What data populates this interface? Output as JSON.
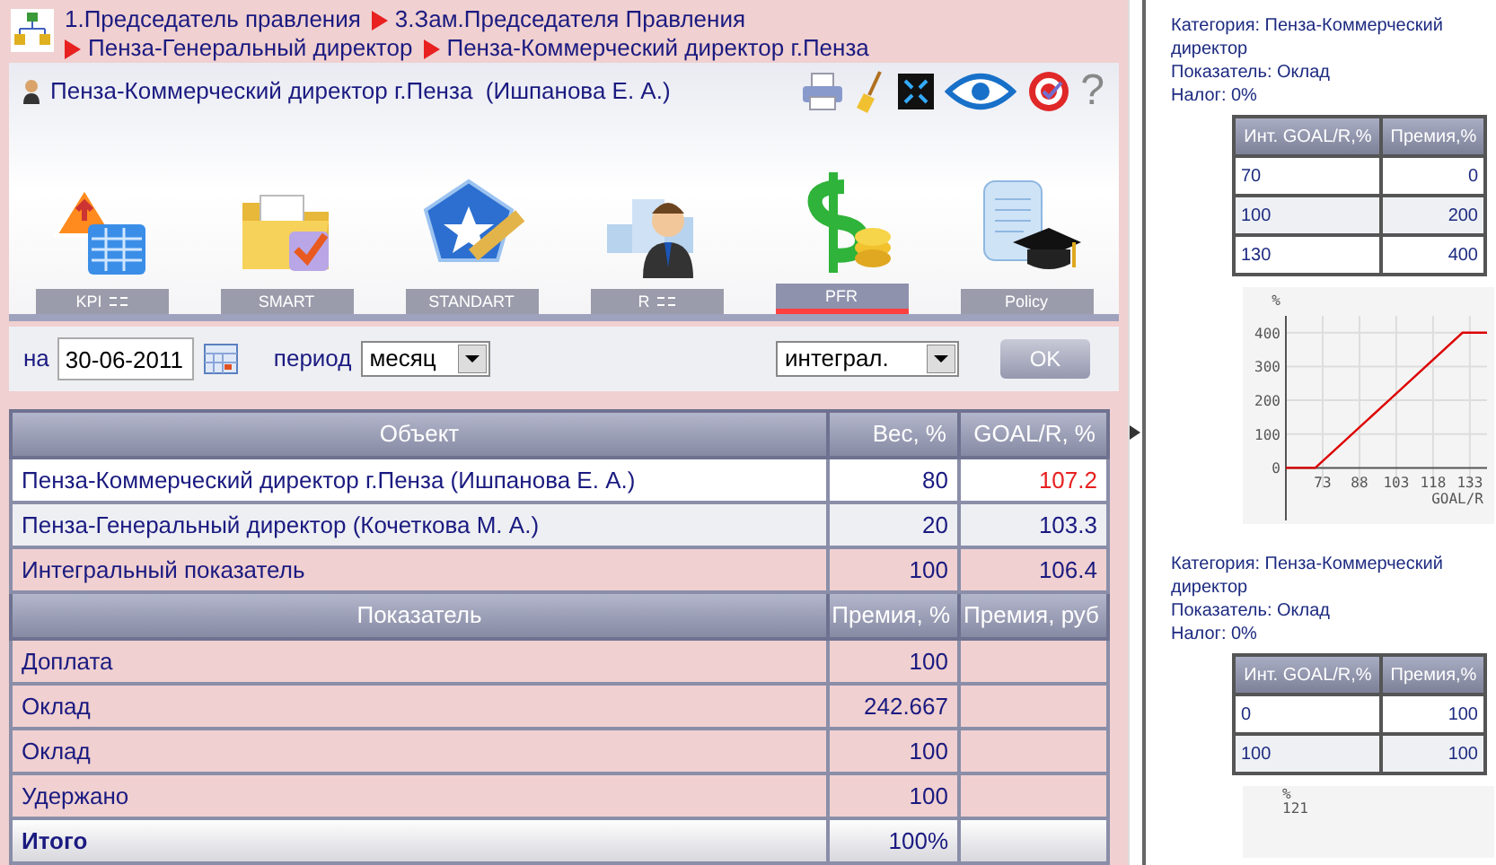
{
  "breadcrumb": [
    {
      "label": "1.Председатель правления"
    },
    {
      "label": "3.Зам.Председателя Правления"
    },
    {
      "label": "Пенза-Генеральный директор"
    },
    {
      "label": "Пенза-Коммерческий директор г.Пенза"
    }
  ],
  "header": {
    "title": "Пенза-Коммерческий директор г.Пенза  (Ишпанова Е. А.)",
    "help": "?"
  },
  "tabs": [
    {
      "label": "KPI",
      "kind": "kpi",
      "grid": true,
      "selected": false
    },
    {
      "label": "SMART",
      "kind": "smart",
      "grid": false,
      "selected": false
    },
    {
      "label": "STANDART",
      "kind": "standart",
      "grid": false,
      "selected": false
    },
    {
      "label": "R",
      "kind": "rank",
      "grid": true,
      "selected": false
    },
    {
      "label": "PFR",
      "kind": "money",
      "grid": false,
      "selected": true
    },
    {
      "label": "Policy",
      "kind": "policy",
      "grid": false,
      "selected": false
    }
  ],
  "filters": {
    "date_label": "на",
    "date": "30-06-2011",
    "period_label": "период",
    "period": "месяц",
    "mode": "интеграл.",
    "ok": "OK"
  },
  "objects": {
    "columns": [
      "Объект",
      "Вес, %",
      "GOAL/R, %"
    ],
    "rows": [
      {
        "name": "Пенза-Коммерческий директор г.Пенза (Ишпанова Е. А.)",
        "weight": "80",
        "goal": "107.2",
        "highlight": true,
        "kind": "item"
      },
      {
        "name": "Пенза-Генеральный директор (Кочеткова М. А.)",
        "weight": "20",
        "goal": "103.3",
        "highlight": false,
        "kind": "item"
      },
      {
        "name": "Интегральный показатель",
        "weight": "100",
        "goal": "106.4",
        "highlight": false,
        "kind": "total"
      }
    ]
  },
  "indicators": {
    "columns": [
      "Показатель",
      "Премия, %",
      "Премия, руб"
    ],
    "rows": [
      {
        "name": "Доплата",
        "percent": "100",
        "kind": "item"
      },
      {
        "name": "Оклад",
        "percent": "242.667",
        "kind": "item"
      },
      {
        "name": "Оклад",
        "percent": "100",
        "kind": "item"
      },
      {
        "name": "Удержано",
        "percent": "100",
        "kind": "item"
      },
      {
        "name": "Итого",
        "percent": "100%",
        "kind": "total"
      }
    ]
  },
  "details": [
    {
      "lines": [
        "Категория: Пенза-Коммерческий директор",
        "Показатель: Оклад",
        "Налог: 0%"
      ],
      "columns": [
        "Инт. GOAL/R,%",
        "Премия,%"
      ],
      "rows": [
        [
          "70",
          "0"
        ],
        [
          "100",
          "200"
        ],
        [
          "130",
          "400"
        ]
      ],
      "chart_data": {
        "type": "line",
        "xlabel": "GOAL/R",
        "ylabel": "%",
        "x": [
          58,
          70,
          100,
          130,
          140
        ],
        "grid": true,
        "series": [
          {
            "color": "#dd0000",
            "values": [
              0,
              0,
              200,
              400,
              400
            ]
          }
        ],
        "xlim": [
          58,
          140
        ],
        "ylim": [
          -60,
          450
        ],
        "xticks": [
          73,
          88,
          103,
          118,
          133
        ],
        "yticks": [
          0,
          100,
          200,
          300,
          400
        ]
      }
    },
    {
      "lines": [
        "Категория: Пенза-Коммерческий директор",
        "Показатель: Оклад",
        "Налог: 0%"
      ],
      "columns": [
        "Инт. GOAL/R,%",
        "Премия,%"
      ],
      "rows": [
        [
          "0",
          "100"
        ],
        [
          "100",
          "100"
        ]
      ],
      "chart_stub": {
        "ylabel": "%",
        "top_tick": "121"
      }
    }
  ]
}
